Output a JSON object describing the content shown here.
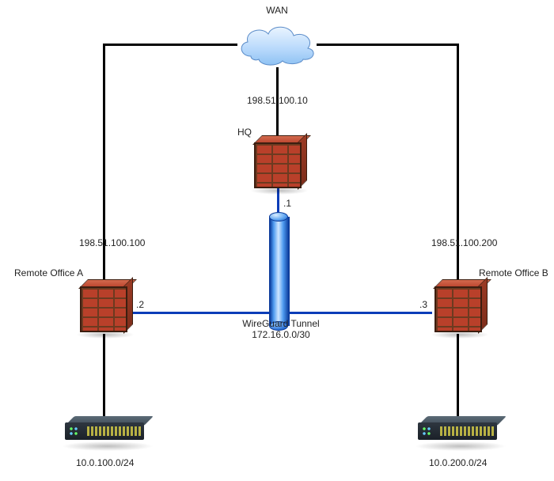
{
  "wan_label": "WAN",
  "hq": {
    "label": "HQ",
    "wan_ip": "198.51.100.10",
    "tunnel_host": ".1"
  },
  "tunnel": {
    "name": "WireGuard Tunnel",
    "subnet": "172.16.0.0/30"
  },
  "remote_a": {
    "label": "Remote Office A",
    "wan_ip": "198.51.100.100",
    "tunnel_host": ".2",
    "lan_subnet": "10.0.100.0/24"
  },
  "remote_b": {
    "label": "Remote Office B",
    "wan_ip": "198.51.100.200",
    "tunnel_host": ".3",
    "lan_subnet": "10.0.200.0/24"
  }
}
